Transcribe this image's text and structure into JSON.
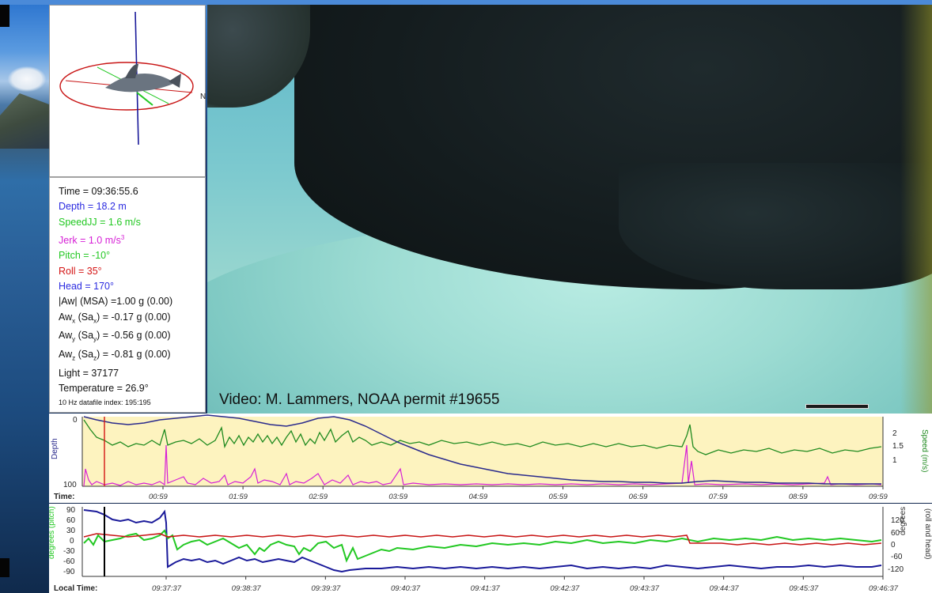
{
  "info_panel": {
    "time": "Time = 09:36:55.6",
    "depth": "Depth = 18.2 m",
    "speed": "SpeedJJ = 1.6 m/s",
    "jerk": "Jerk = 1.0 m/s",
    "jerk_sup": "3",
    "pitch": "Pitch = -10°",
    "roll": "Roll = 35°",
    "head": "Head = 170°",
    "aw_msa": "|Aw| (MSA) =1.00 g (0.00)",
    "awx": {
      "pre": "Aw",
      "sub": "x",
      "mid": " (Sa",
      "sub2": "x",
      "post": ") = -0.17 g (0.00)"
    },
    "awy": {
      "pre": "Aw",
      "sub": "y",
      "mid": " (Sa",
      "sub2": "y",
      "post": ") = -0.56 g (0.00)"
    },
    "awz": {
      "pre": "Aw",
      "sub": "z",
      "mid": " (Sa",
      "sub2": "z",
      "post": ") = -0.81 g (0.00)"
    },
    "light": "Light = 37177",
    "temperature": "Temperature = 26.9°",
    "datafile": "10 Hz datafile index: 195:195"
  },
  "video": {
    "credit": "Video: M. Lammers, NOAA permit #19655"
  },
  "depth_chart": {
    "y_left_label": "Depth",
    "y_left_ticks": [
      "0",
      "100"
    ],
    "y_right_label": "Speed (m/s)",
    "y_right_ticks": [
      "2",
      "1.5",
      "1"
    ],
    "time_label": "Time:",
    "x_ticks": [
      "00:59",
      "01:59",
      "02:59",
      "03:59",
      "04:59",
      "05:59",
      "06:59",
      "07:59",
      "08:59",
      "09:59"
    ]
  },
  "attitude_chart": {
    "y_left_label": "degrees (pitch)",
    "y_left_ticks": [
      "90",
      "60",
      "30",
      "0",
      "-30",
      "-60",
      "-90"
    ],
    "y_right_label": "degrees",
    "y_right_sublabel": "(roll and head)",
    "y_right_ticks": [
      "120",
      "60",
      "0",
      "-60",
      "-120"
    ],
    "time_label": "Local Time:",
    "x_ticks": [
      "09:37:37",
      "09:38:37",
      "09:39:37",
      "09:40:37",
      "09:41:37",
      "09:42:37",
      "09:43:37",
      "09:44:37",
      "09:45:37",
      "09:46:37"
    ]
  },
  "colors": {
    "depth_line": "#2a2a8c",
    "speed_line": "#1f8a1f",
    "jerk_line": "#d61fd6",
    "chart_bg": "#fdf3bf",
    "cursor": "#d41414",
    "pitch_line": "#22c822",
    "roll_line": "#c81414",
    "head_line": "#1a1a9a"
  }
}
